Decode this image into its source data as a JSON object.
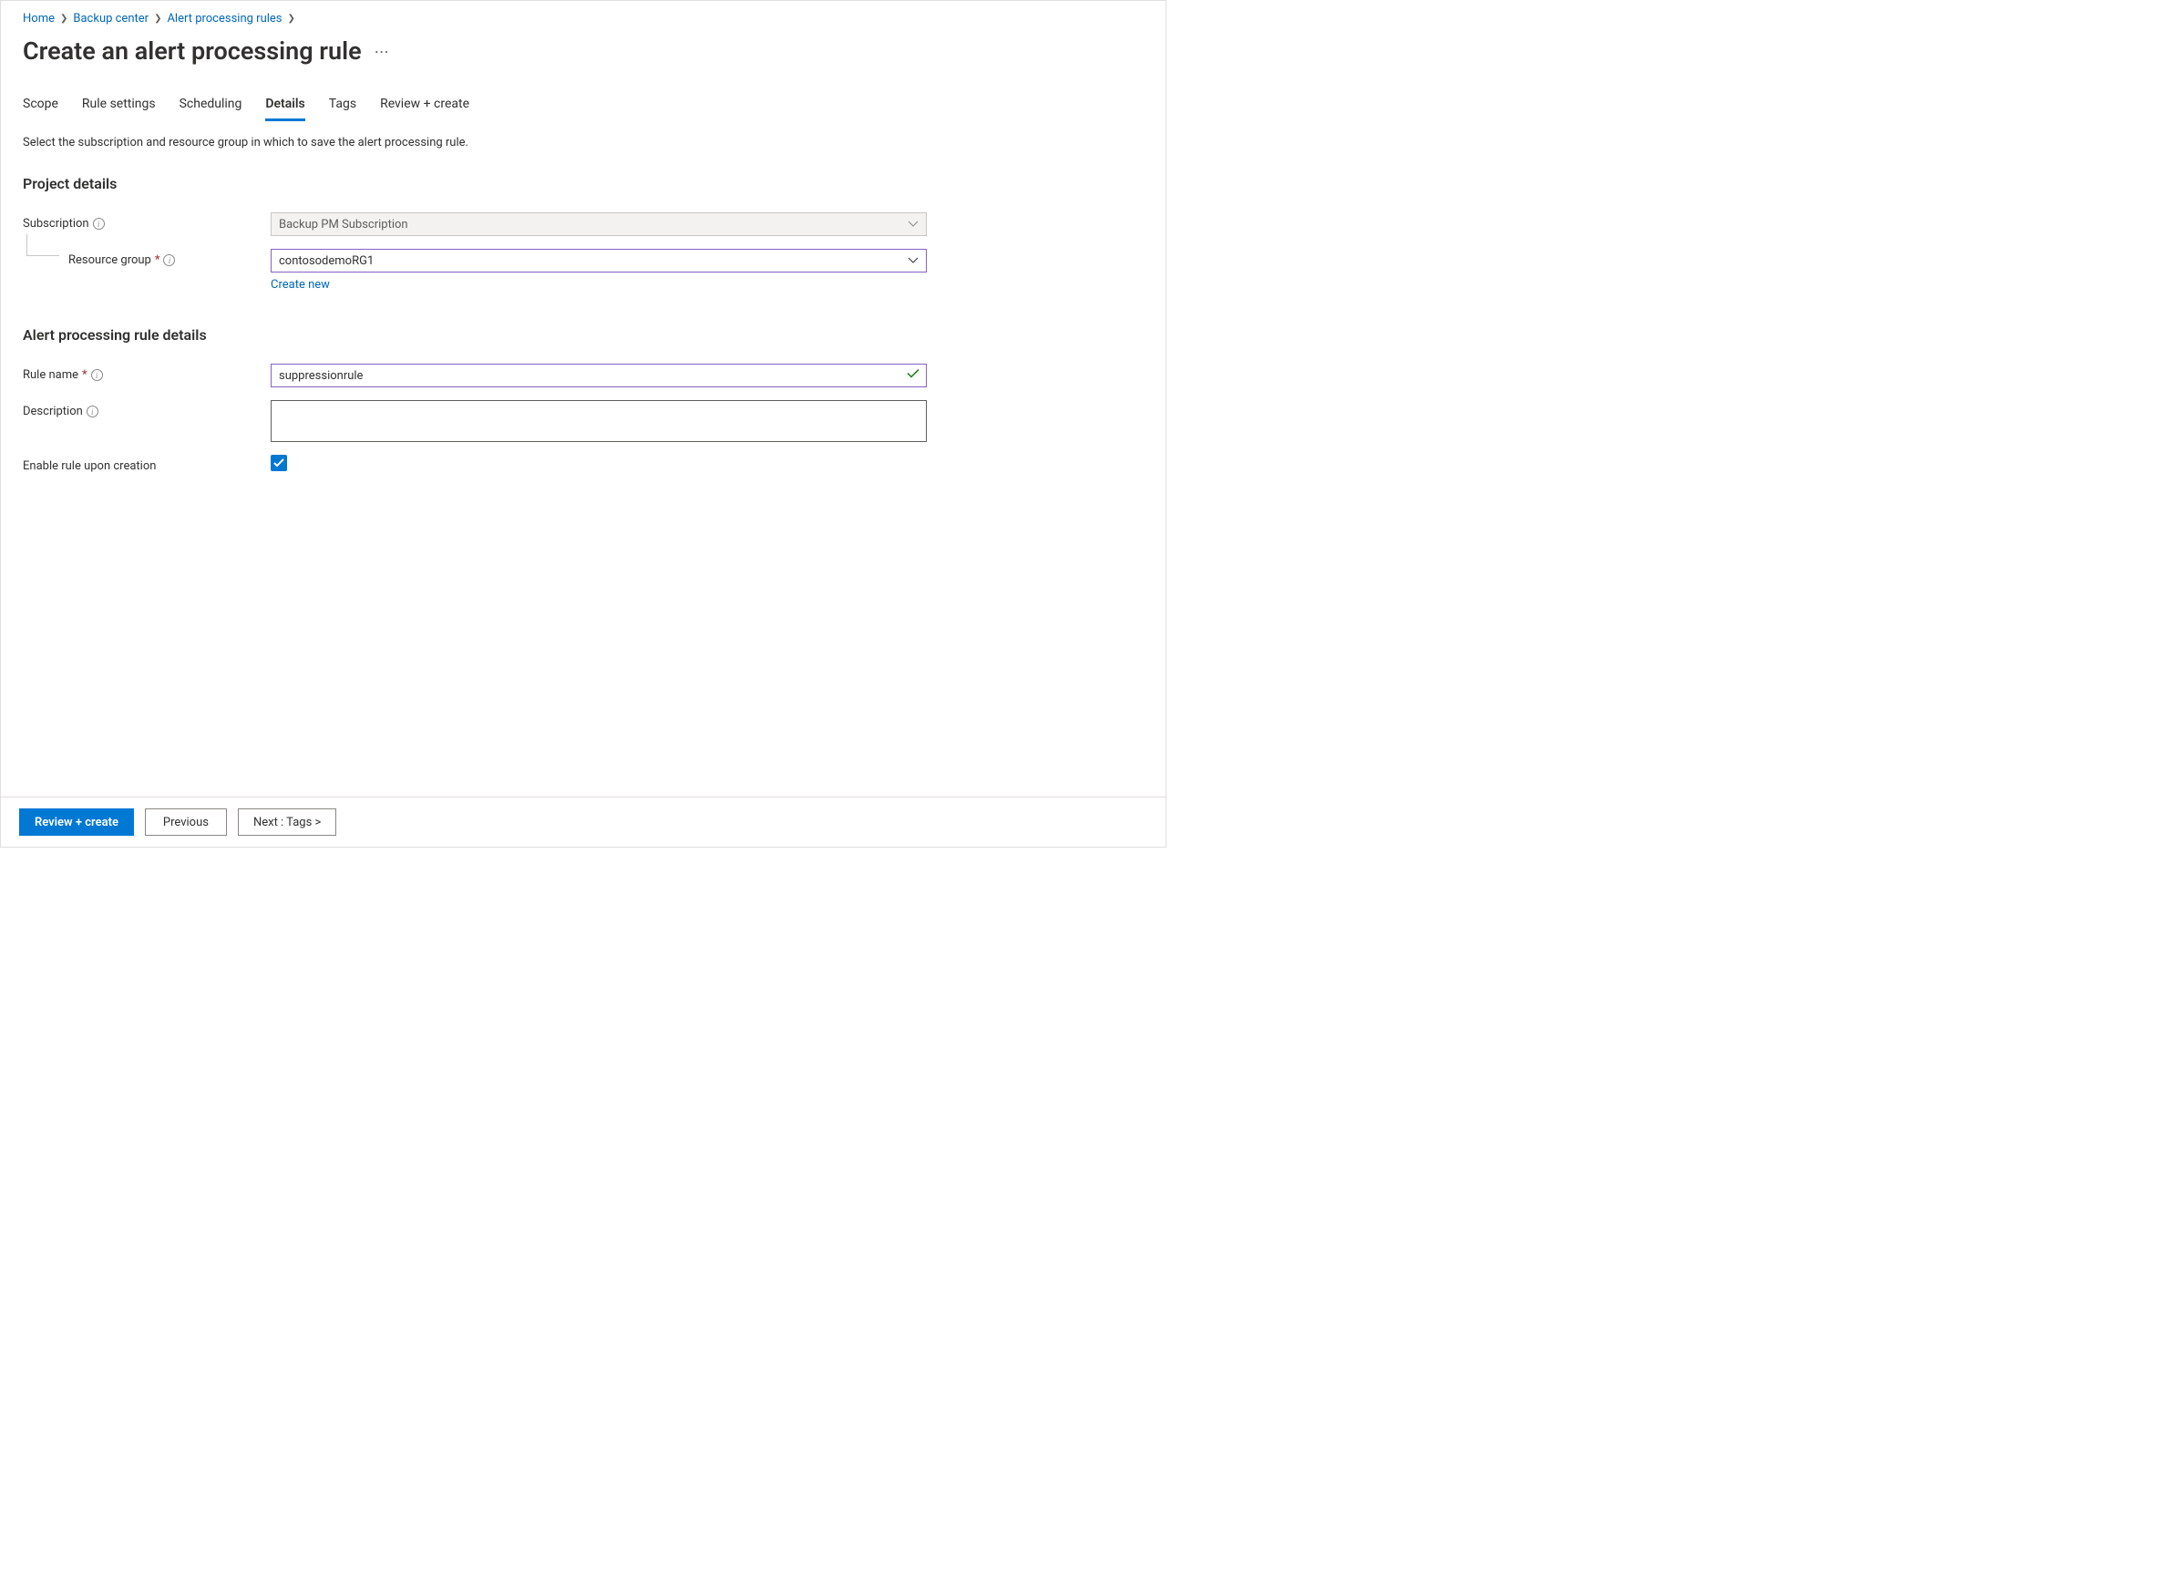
{
  "breadcrumb": {
    "items": [
      "Home",
      "Backup center",
      "Alert processing rules"
    ]
  },
  "page": {
    "title": "Create an alert processing rule"
  },
  "tabs": {
    "items": [
      {
        "label": "Scope",
        "active": false
      },
      {
        "label": "Rule settings",
        "active": false
      },
      {
        "label": "Scheduling",
        "active": false
      },
      {
        "label": "Details",
        "active": true
      },
      {
        "label": "Tags",
        "active": false
      },
      {
        "label": "Review + create",
        "active": false
      }
    ]
  },
  "helper_text": "Select the subscription and resource group in which to save the alert processing rule.",
  "sections": {
    "project": {
      "heading": "Project details",
      "subscription": {
        "label": "Subscription",
        "value": "Backup PM Subscription"
      },
      "resource_group": {
        "label": "Resource group",
        "value": "contosodemoRG1",
        "create_new": "Create new"
      }
    },
    "rule": {
      "heading": "Alert processing rule details",
      "rule_name": {
        "label": "Rule name",
        "value": "suppressionrule"
      },
      "description": {
        "label": "Description",
        "value": ""
      },
      "enable": {
        "label": "Enable rule upon creation",
        "checked": true
      }
    }
  },
  "footer": {
    "review": "Review + create",
    "previous": "Previous",
    "next": "Next : Tags >"
  }
}
